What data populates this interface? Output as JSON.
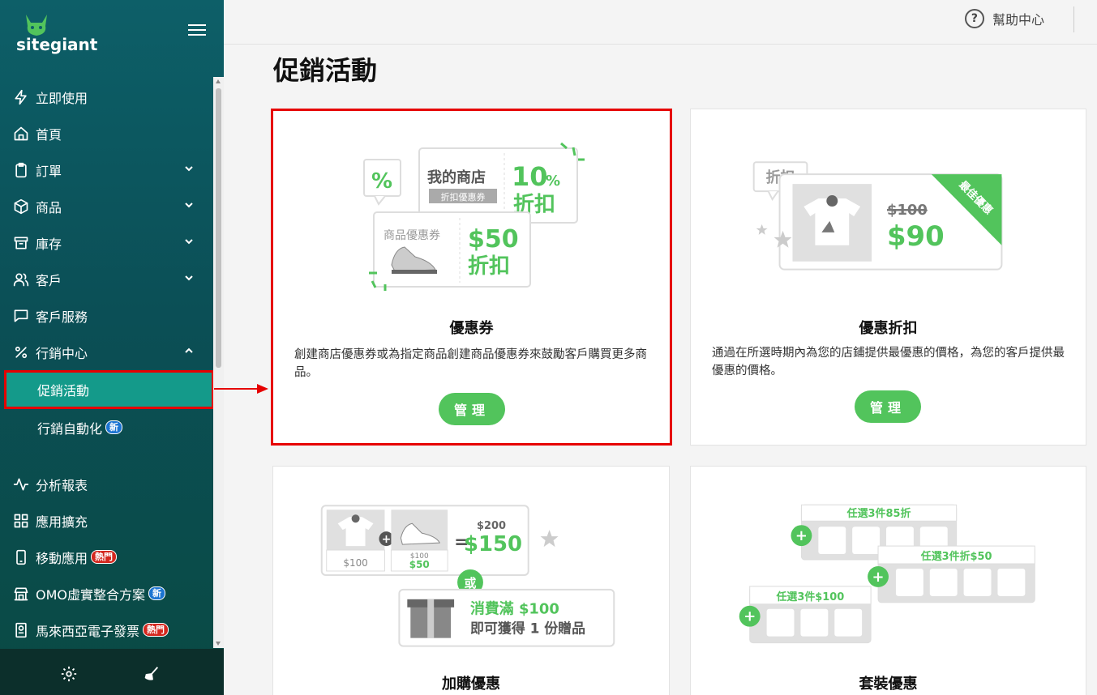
{
  "brand": {
    "logo_text": "sitegiant"
  },
  "sidebar": {
    "items": [
      {
        "label": "立即使用",
        "icon": "lightning-icon"
      },
      {
        "label": "首頁",
        "icon": "home-icon"
      },
      {
        "label": "訂單",
        "icon": "clipboard-icon",
        "expandable": true
      },
      {
        "label": "商品",
        "icon": "box-icon",
        "expandable": true
      },
      {
        "label": "庫存",
        "icon": "archive-icon",
        "expandable": true
      },
      {
        "label": "客戶",
        "icon": "users-icon",
        "expandable": true
      },
      {
        "label": "客戶服務",
        "icon": "chat-icon"
      },
      {
        "label": "行銷中心",
        "icon": "percent-icon",
        "expanded": true
      }
    ],
    "sub_items": [
      {
        "label": "促銷活動",
        "active": true
      },
      {
        "label": "行銷自動化",
        "badge": "新"
      }
    ],
    "items2": [
      {
        "label": "分析報表",
        "icon": "activity-icon"
      },
      {
        "label": "應用擴充",
        "icon": "grid-icon"
      },
      {
        "label": "移動應用",
        "icon": "phone-icon",
        "badge": "熱門"
      },
      {
        "label": "OMO虛實整合方案",
        "icon": "store-icon",
        "badge": "新"
      },
      {
        "label": "馬來西亞電子發票",
        "icon": "receipt-icon",
        "badge": "熱門"
      }
    ]
  },
  "topbar": {
    "help_label": "幫助中心"
  },
  "page_title": "促銷活動",
  "cards": [
    {
      "title": "優惠券",
      "description": "創建商店優惠券或為指定商品創建商品優惠券來鼓勵客戶購買更多商品。",
      "button": "管理",
      "illus": {
        "shop": "我的商店",
        "shop_tag": "折扣優惠券",
        "pct_num": "10",
        "pct_sign": "%",
        "discount_word": "折扣",
        "product_coupon": "商品優惠券",
        "amount": "$50",
        "pct_icon": "%"
      }
    },
    {
      "title": "優惠折扣",
      "description": "通過在所選時期內為您的店鋪提供最優惠的價格，為您的客戶提供最優惠的價格。",
      "button": "管理",
      "illus": {
        "tag": "折扣",
        "old_price": "$100",
        "new_price": "$90",
        "ribbon": "最佳優惠"
      }
    },
    {
      "title": "加購優惠",
      "illus": {
        "p1": "$100",
        "p2_old": "$100",
        "p2_new": "$50",
        "total_old": "$200",
        "total_new": "$150",
        "or": "或",
        "gift_line1": "消費滿 $100",
        "gift_line2": "即可獲得 1 份贈品"
      }
    },
    {
      "title": "套裝優惠",
      "illus": {
        "bundle1": "任選3件85折",
        "bundle2": "任選3件折$50",
        "bundle3": "任選3件$100"
      }
    }
  ]
}
